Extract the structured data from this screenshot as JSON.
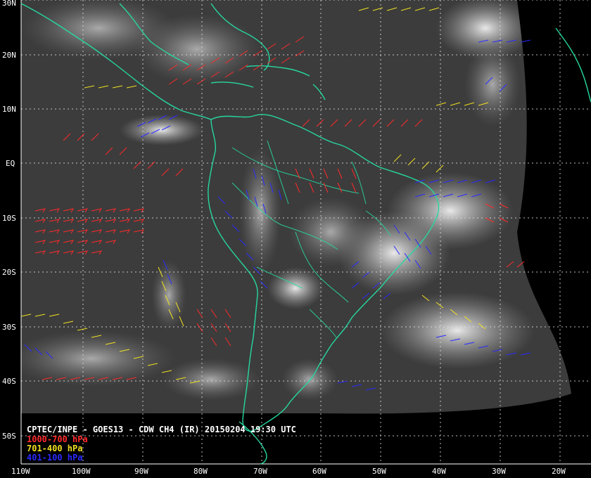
{
  "title": "CPTEC/INPE - GOES13 - CDW CH4 (IR) 20150204 19:30 UTC",
  "legend": [
    {
      "label": "1000-700 hPa",
      "color": "#ff2a2a"
    },
    {
      "label": "701-400 hPa",
      "color": "#f0e020"
    },
    {
      "label": "401-100 hPa",
      "color": "#2a2aff"
    }
  ],
  "lat_labels": [
    "30N",
    "20N",
    "10N",
    "EQ",
    "10S",
    "20S",
    "30S",
    "40S",
    "50S"
  ],
  "lon_labels": [
    "110W",
    "100W",
    "90W",
    "80W",
    "70W",
    "60W",
    "50W",
    "40W",
    "30W",
    "20W"
  ],
  "colors": {
    "background": "#000000",
    "coastline": "#27d7a0",
    "grid": "#dddddd",
    "text": "#ffffff"
  }
}
